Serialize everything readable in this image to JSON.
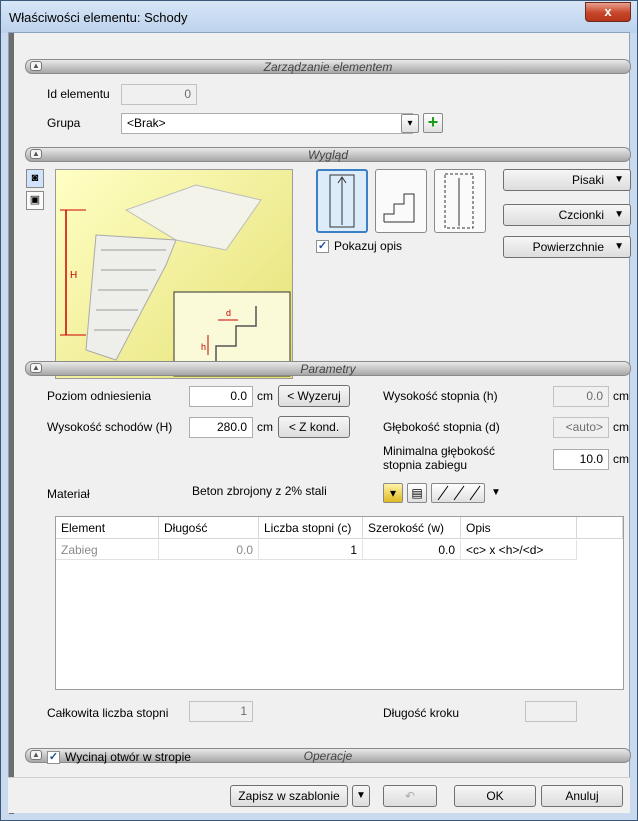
{
  "window": {
    "title": "Właściwości elementu: Schody",
    "close_symbol": "x"
  },
  "sections": {
    "management": "Zarządzanie elementem",
    "appearance": "Wygląd",
    "parameters": "Parametry",
    "operations": "Operacje"
  },
  "management": {
    "id_label": "Id elementu",
    "id_value": "0",
    "group_label": "Grupa",
    "group_value": "<Brak>"
  },
  "appearance": {
    "show_description_label": "Pokazuj opis",
    "show_description_checked": true,
    "pens_button": "Pisaki",
    "fonts_button": "Czcionki",
    "surfaces_button": "Powierzchnie",
    "preview_labels": {
      "h_total": "H",
      "h_step": "h",
      "d_step": "d"
    }
  },
  "parameters": {
    "ref_level_label": "Poziom odniesienia",
    "ref_level_value": "0.0",
    "ref_level_unit": "cm",
    "reset_button": "< Wyzeruj",
    "stairs_height_label": "Wysokość schodów (H)",
    "stairs_height_value": "280.0",
    "stairs_height_unit": "cm",
    "from_storey_button": "< Z kond.",
    "step_height_label": "Wysokość stopnia (h)",
    "step_height_value": "0.0",
    "step_height_unit": "cm",
    "step_depth_label": "Głębokość stopnia (d)",
    "step_depth_value": "<auto>",
    "step_depth_unit": "cm",
    "min_depth_label_line1": "Minimalna głębokość",
    "min_depth_label_line2": "stopnia zabiegu",
    "min_depth_value": "10.0",
    "min_depth_unit": "cm",
    "material_label": "Materiał",
    "material_value": "Beton zbrojony z 2% stali"
  },
  "table": {
    "columns": [
      "Element",
      "Długość",
      "Liczba stopni (c)",
      "Szerokość (w)",
      "Opis"
    ],
    "rows": [
      {
        "element": "Zabieg",
        "length": "0.0",
        "steps": "1",
        "width": "0.0",
        "description": "<c> x <h>/<d>"
      }
    ]
  },
  "totals": {
    "total_steps_label": "Całkowita liczba stopni",
    "total_steps_value": "1",
    "stride_length_label": "Długość kroku",
    "stride_length_value": ""
  },
  "operations": {
    "cut_opening_label": "Wycinaj otwór w stropie",
    "cut_opening_checked": true
  },
  "footer": {
    "save_template_button": "Zapisz w szablonie",
    "ok_button": "OK",
    "cancel_button": "Anuluj"
  }
}
